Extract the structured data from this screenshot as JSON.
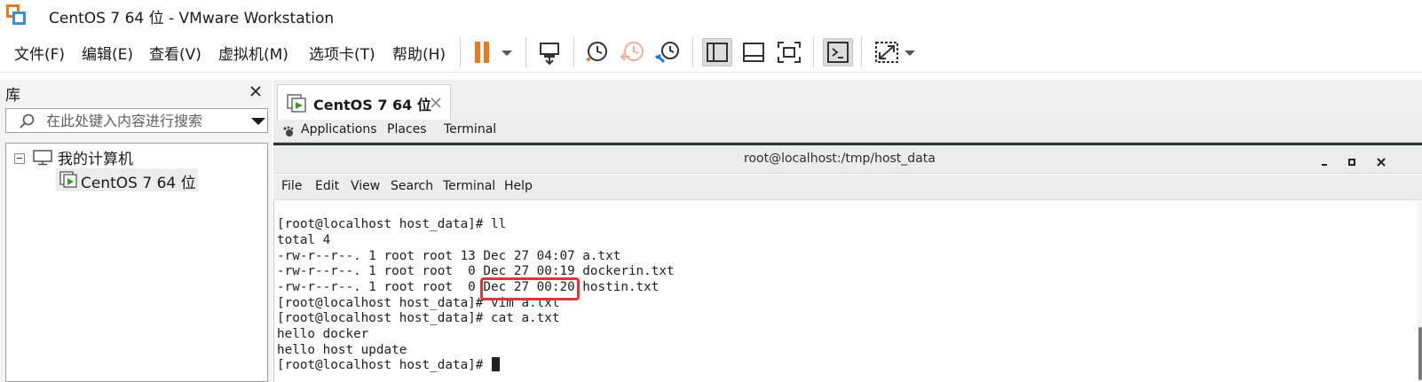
{
  "window": {
    "title": "CentOS 7 64 位 - VMware Workstation",
    "logo_icon": "vmware-workstation-icon"
  },
  "menubar": {
    "items": [
      "文件(F)",
      "编辑(E)",
      "查看(V)",
      "虚拟机(M)",
      "选项卡(T)",
      "帮助(H)"
    ],
    "toolbar_icons": [
      "pause-icon",
      "dropdown-arrow-icon",
      "send-ctrl-alt-del-icon",
      "snapshot-icon",
      "revert-snapshot-icon",
      "snapshot-manager-icon",
      "show-library-icon",
      "thumbnail-bar-icon",
      "full-screen-icon",
      "console-view-icon",
      "stretch-guest-icon",
      "dropdown-arrow-icon"
    ],
    "accent_color": "#e8791f"
  },
  "library": {
    "title": "库",
    "search_placeholder": "在此处键入内容进行搜索",
    "tree_root": "我的计算机",
    "tree_vm": "CentOS 7 64 位"
  },
  "tab": {
    "label": "CentOS 7 64 位"
  },
  "gnome_bar": {
    "items": [
      "Applications",
      "Places",
      "Terminal"
    ]
  },
  "terminal": {
    "window_title": "root@localhost:/tmp/host_data",
    "menu": [
      "File",
      "Edit",
      "View",
      "Search",
      "Terminal",
      "Help"
    ],
    "lines": [
      "[root@localhost host_data]# ll",
      "total 4",
      "-rw-r--r--. 1 root root 13 Dec 27 04:07 a.txt",
      "-rw-r--r--. 1 root root  0 Dec 27 00:19 dockerin.txt",
      "-rw-r--r--. 1 root root  0 Dec 27 00:20 hostin.txt",
      "[root@localhost host_data]# vim a.txt",
      "[root@localhost host_data]# cat a.txt",
      "hello docker",
      "hello host update",
      "[root@localhost host_data]# "
    ],
    "highlight_color": "#e23434"
  }
}
